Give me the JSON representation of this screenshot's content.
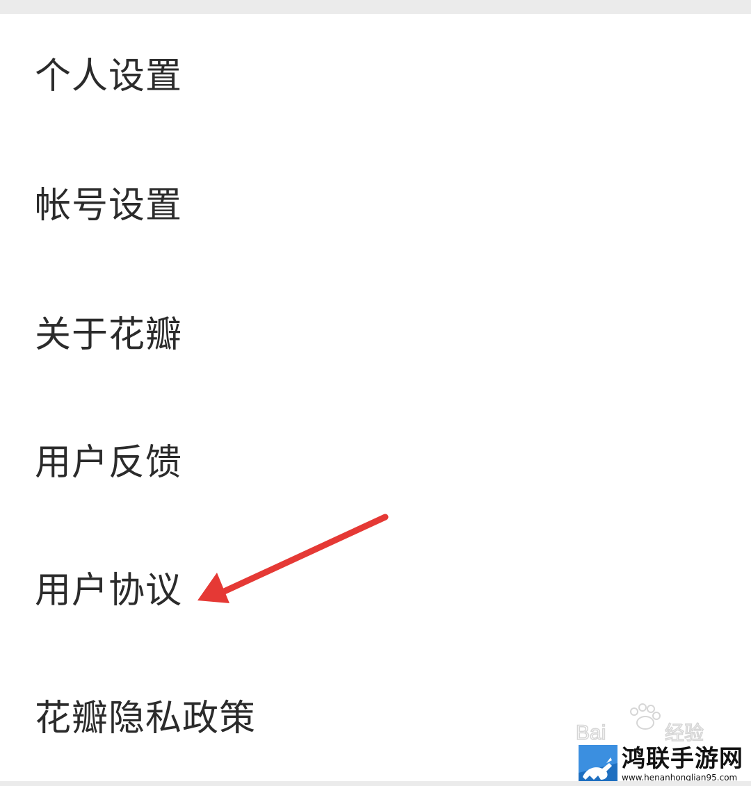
{
  "menu": {
    "items": [
      {
        "label": "个人设置"
      },
      {
        "label": "帐号设置"
      },
      {
        "label": "关于花瓣"
      },
      {
        "label": "用户反馈"
      },
      {
        "label": "用户协议"
      },
      {
        "label": "花瓣隐私政策"
      }
    ]
  },
  "annotation": {
    "arrow_color": "#e53935",
    "points_to": "用户协议"
  },
  "watermarks": {
    "baidu": "Baidu经验",
    "site_name": "鸿联手游网",
    "site_url": "www.henanhonglian95.com"
  }
}
